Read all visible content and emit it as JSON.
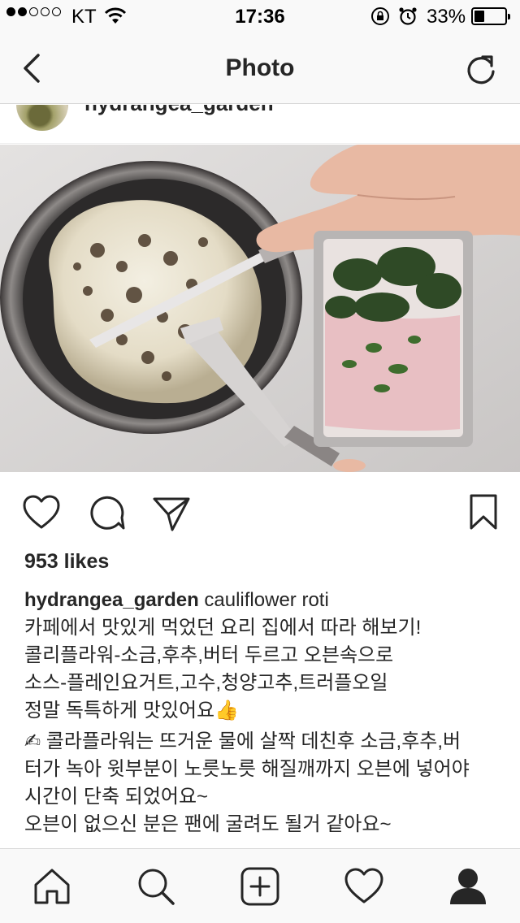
{
  "status_bar": {
    "carrier": "KT",
    "time": "17:36",
    "battery_percent": "33%",
    "battery_level": 0.33,
    "signal_bars_filled": 2,
    "signal_bars_total": 5
  },
  "nav": {
    "title": "Photo",
    "back_icon": "chevron-left-icon",
    "refresh_icon": "refresh-icon"
  },
  "post": {
    "username": "hydrangea_garden",
    "likes": "953 likes",
    "caption_title": "cauliflower roti",
    "caption_lines": [
      "카페에서 맛있게 먹었던 요리 집에서 따라 해보기!",
      "콜리플라워-소금,후추,버터 두르고 오븐속으로",
      "소스-플레인요거트,고수,청양고추,트러플오일",
      "정말 독특하게 맛있어요👍"
    ],
    "caption_lines_2": [
      "✍ 콜라플라워는 뜨거운 물에 살짝 데친후 소금,후추,버",
      "터가 녹아 윗부분이 노릇노릇 해질깨까지 오븐에 넣어야",
      "시간이 단축 되었어요~",
      "오븐이 없으신 분은 팬에 굴려도 될거 같아요~"
    ]
  },
  "actions": [
    "heart-icon",
    "comment-icon",
    "share-icon",
    "bookmark-icon"
  ],
  "tab_bar": [
    "home-icon",
    "search-icon",
    "add-icon",
    "activity-heart-icon",
    "profile-icon"
  ],
  "colors": {
    "text": "#262626",
    "bar_bg": "#f9f9f9",
    "divider": "#d6d6d6"
  }
}
